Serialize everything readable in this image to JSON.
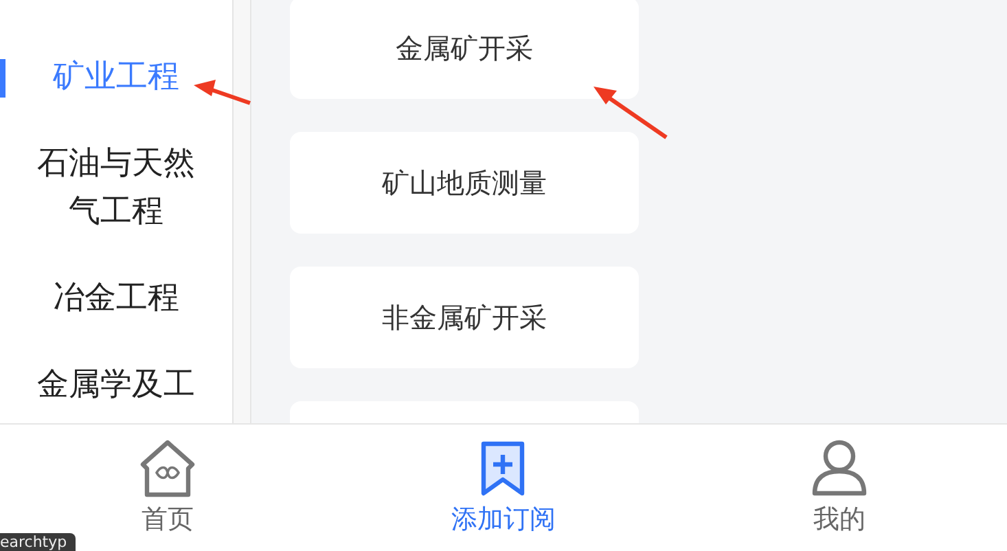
{
  "sidebar": {
    "items": [
      {
        "label": "矿业工程",
        "selected": true
      },
      {
        "label": "石油与天然气工程",
        "selected": false
      },
      {
        "label": "冶金工程",
        "selected": false
      },
      {
        "label": "金属学及工",
        "selected": false
      }
    ]
  },
  "cards": [
    {
      "kind": "text",
      "label": "金属矿开采"
    },
    {
      "kind": "text",
      "label": "矿山地质测量"
    },
    {
      "kind": "text",
      "label": "非金属矿开采"
    },
    {
      "kind": "cut_off"
    }
  ],
  "tab_bar": {
    "items": [
      {
        "label": "首页",
        "selected": false
      },
      {
        "label": "添加订阅",
        "selected": true
      },
      {
        "label": "我的",
        "selected": false
      }
    ]
  },
  "tooltip": {
    "text": "earchtyp"
  }
}
